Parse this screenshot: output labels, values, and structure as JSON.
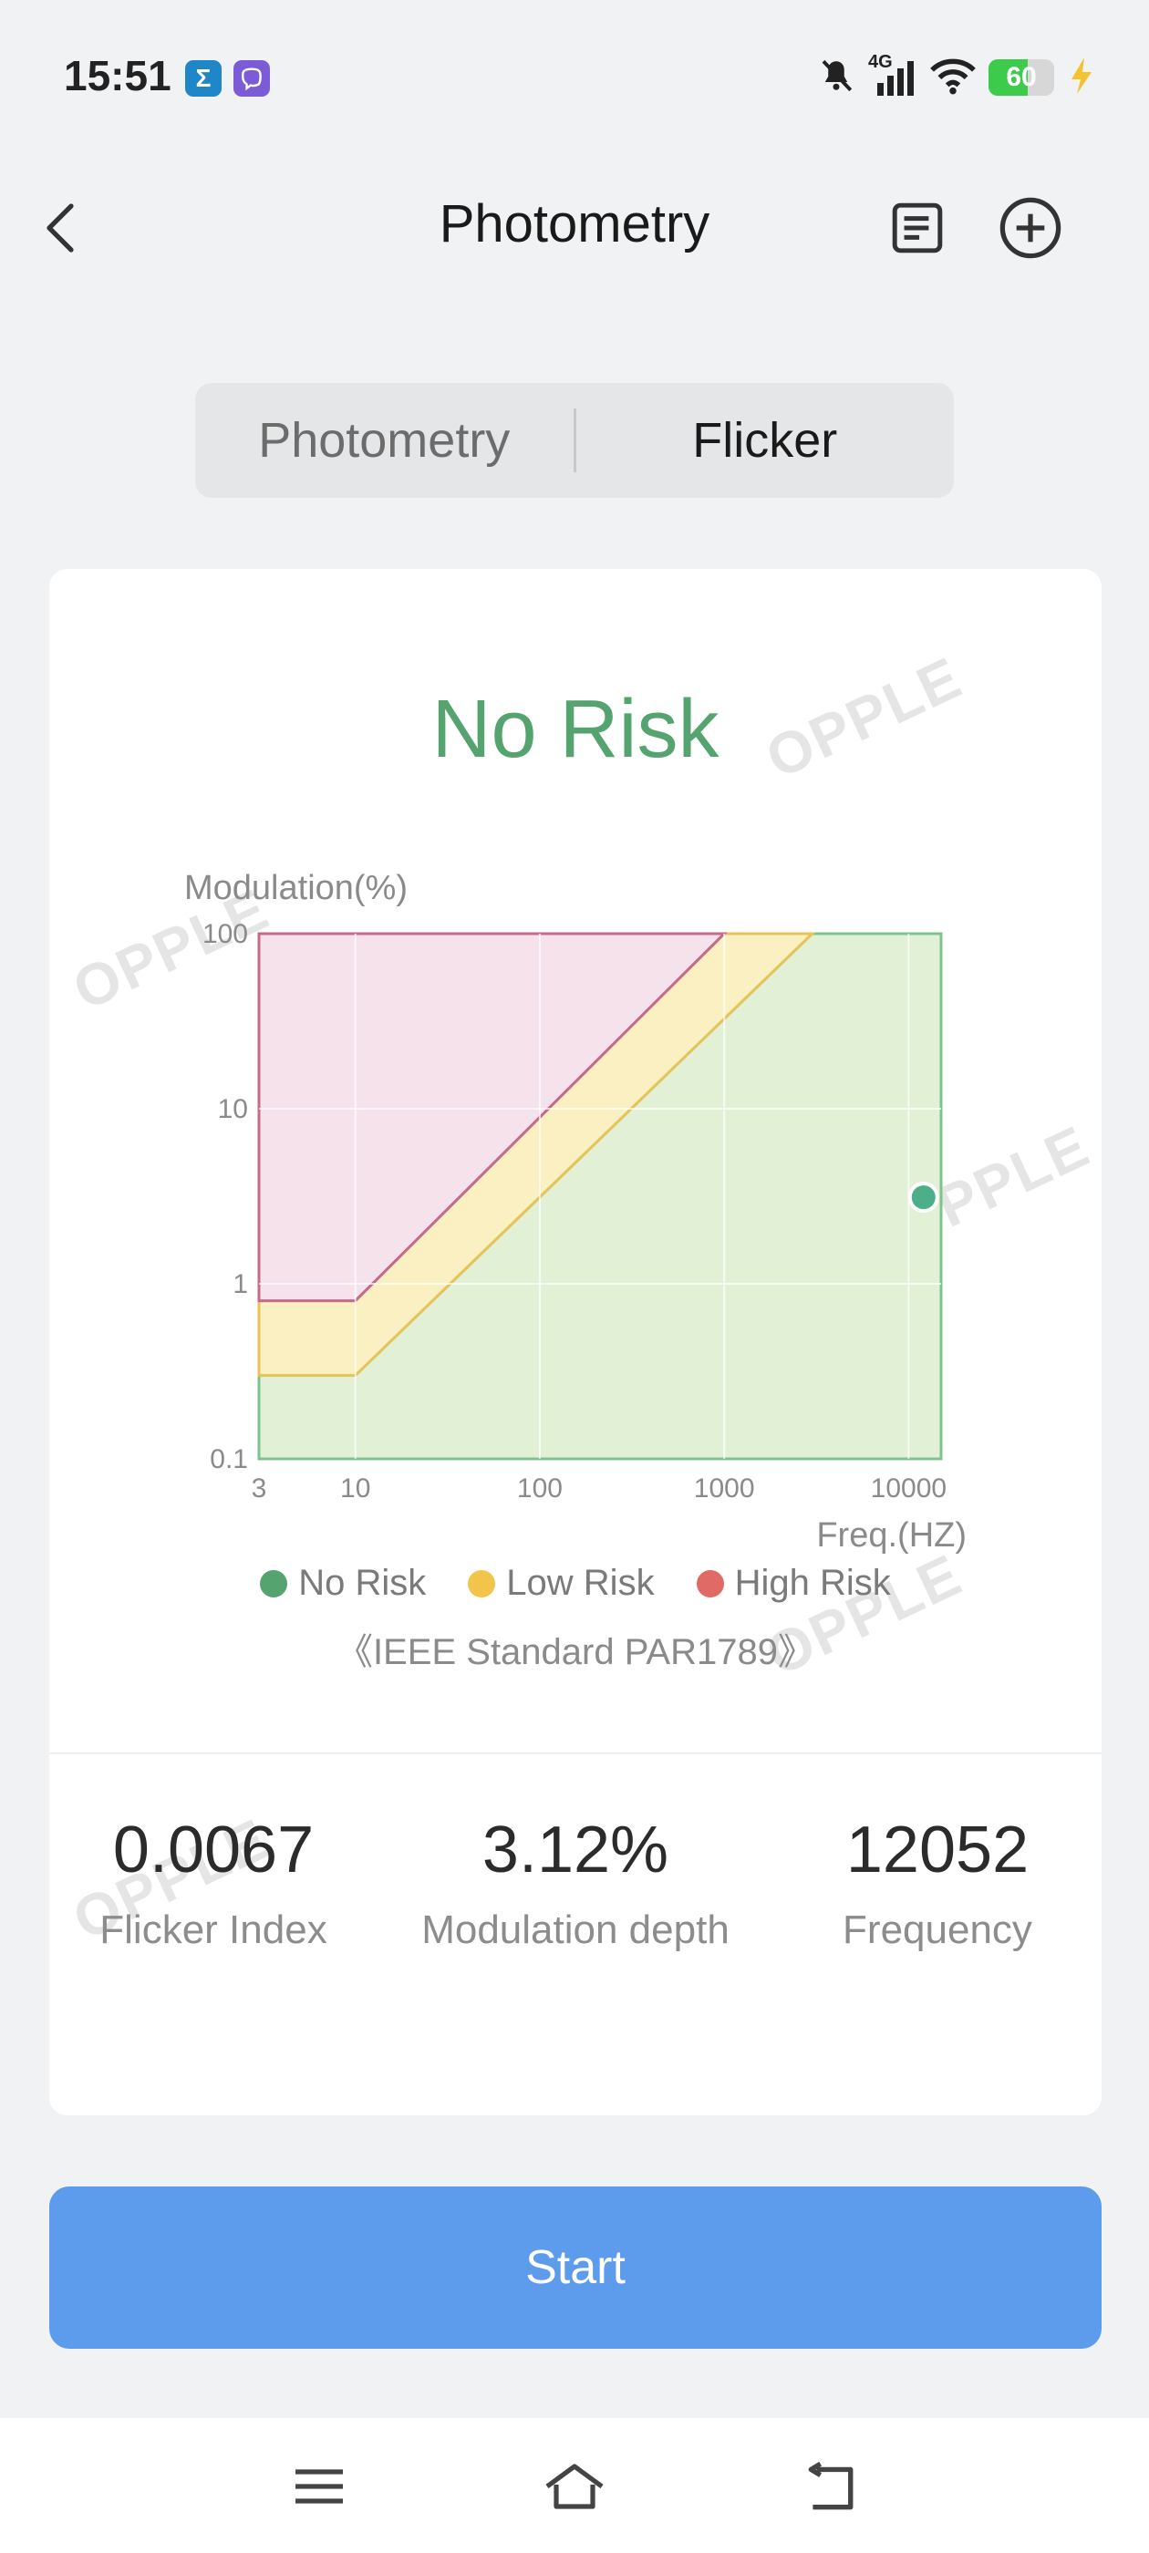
{
  "status_bar": {
    "time": "15:51",
    "apps": [
      "sigma-app-icon",
      "viber-app-icon"
    ],
    "sigma_glyph": "Σ",
    "network": "4G",
    "battery_percent": 60,
    "battery_label": "60"
  },
  "header": {
    "title": "Photometry",
    "back_icon": "chevron-left-icon",
    "doc_icon": "document-icon",
    "add_icon": "plus-circle-icon"
  },
  "segment": {
    "tabs": [
      "Photometry",
      "Flicker"
    ],
    "active_index": 1
  },
  "card": {
    "risk_status": "No Risk",
    "watermark": "OPPLE",
    "legend_items": [
      {
        "label": "No Risk",
        "color": "#55a36e"
      },
      {
        "label": "Low Risk",
        "color": "#f2c54a"
      },
      {
        "label": "High Risk",
        "color": "#e06b66"
      }
    ],
    "standard_note": "《IEEE Standard PAR1789》",
    "stats": [
      {
        "value": "0.0067",
        "label": "Flicker Index"
      },
      {
        "value": "3.12%",
        "label": "Modulation depth"
      },
      {
        "value": "12052",
        "label": "Frequency"
      }
    ],
    "pager": {
      "pages": 2,
      "active_page": 1
    }
  },
  "chart_data": {
    "type": "area",
    "ylabel": "Modulation(%)",
    "xlabel": "Freq.(HZ)",
    "x_scale": "log",
    "y_scale": "log",
    "xlim": [
      3,
      15000
    ],
    "ylim": [
      0.1,
      100
    ],
    "x_ticks": [
      "3",
      "10",
      "100",
      "1000",
      "10000"
    ],
    "y_ticks": [
      "0.1",
      "1",
      "10",
      "100"
    ],
    "grid": true,
    "regions": [
      {
        "name": "High Risk",
        "color": "#e06b66",
        "boundary": [
          [
            3,
            0.8
          ],
          [
            10,
            0.8
          ],
          [
            1000,
            100
          ],
          [
            3,
            100
          ]
        ]
      },
      {
        "name": "Low Risk",
        "color": "#f2c54a",
        "boundary": [
          [
            3,
            0.3
          ],
          [
            10,
            0.3
          ],
          [
            3000,
            100
          ],
          [
            1000,
            100
          ],
          [
            10,
            0.8
          ],
          [
            3,
            0.8
          ]
        ]
      },
      {
        "name": "No Risk",
        "color": "#55a36e",
        "boundary": [
          [
            3,
            0.1
          ],
          [
            15000,
            0.1
          ],
          [
            15000,
            100
          ],
          [
            3000,
            100
          ],
          [
            10,
            0.3
          ],
          [
            3,
            0.3
          ]
        ]
      }
    ],
    "measurement": {
      "x": 12052,
      "y": 3.12,
      "color": "#4caf8a"
    }
  },
  "start_button": {
    "label": "Start"
  },
  "bottom_nav": {
    "items": [
      "menu-icon",
      "home-icon",
      "back-icon"
    ]
  }
}
